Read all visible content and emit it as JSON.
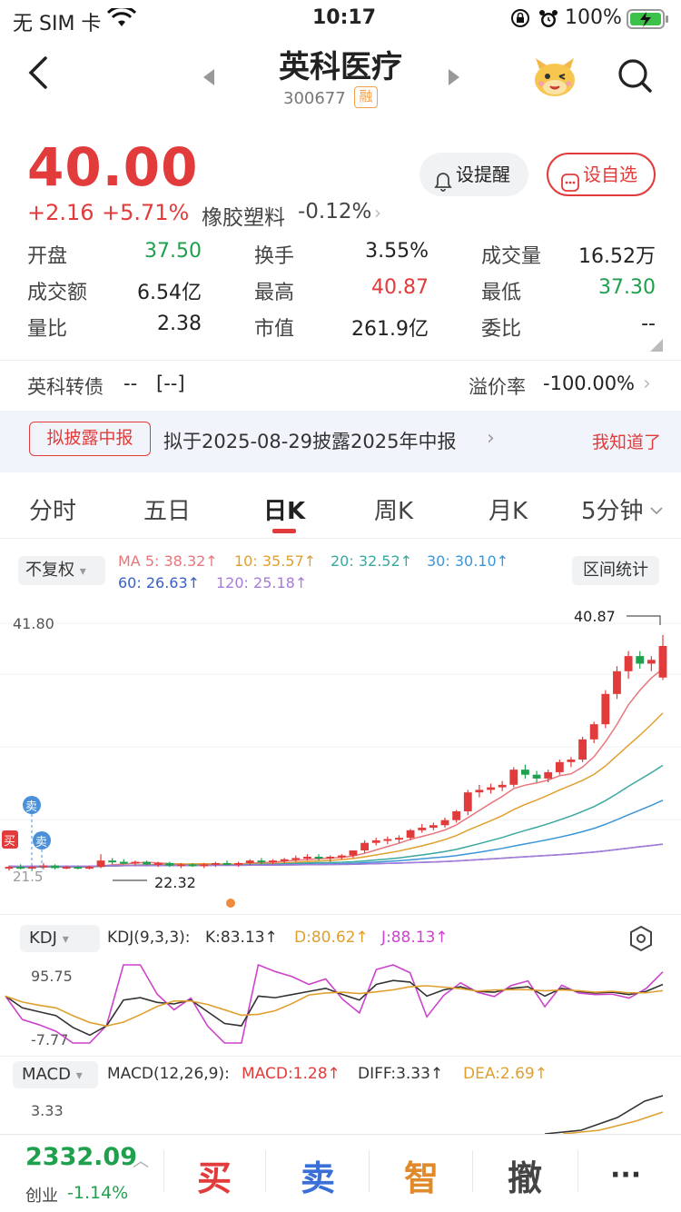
{
  "status": {
    "carrier": "无 SIM 卡",
    "time": "10:17",
    "battery": "100%"
  },
  "header": {
    "title": "英科医疗",
    "code": "300677",
    "badge": "融"
  },
  "price": {
    "last": "40.00",
    "change": "+2.16",
    "change_pct": "+5.71%",
    "sector": "橡胶塑料",
    "sector_pct": "-0.12%",
    "remind_label": "设提醒",
    "fav_label": "设自选"
  },
  "stats": [
    {
      "label": "开盘",
      "value": "37.50",
      "color": "#1fa04d"
    },
    {
      "label": "换手",
      "value": "3.55%",
      "color": "#222222"
    },
    {
      "label": "成交量",
      "value": "16.52万",
      "color": "#222222"
    },
    {
      "label": "成交额",
      "value": "6.54亿",
      "color": "#222222"
    },
    {
      "label": "最高",
      "value": "40.87",
      "color": "#e23b3b"
    },
    {
      "label": "最低",
      "value": "37.30",
      "color": "#1fa04d"
    },
    {
      "label": "量比",
      "value": "2.38",
      "color": "#222222"
    },
    {
      "label": "市值",
      "value": "261.9亿",
      "color": "#222222"
    },
    {
      "label": "委比",
      "value": "--",
      "color": "#222222"
    }
  ],
  "bond": {
    "label": "英科转债",
    "value": "--",
    "bracket": "[--]",
    "premium_label": "溢价率",
    "premium_value": "-100.00%"
  },
  "notice": {
    "tag": "拟披露中报",
    "text": "拟于2025-08-29披露2025年中报",
    "dismiss": "我知道了"
  },
  "tabs": [
    "分时",
    "五日",
    "日K",
    "周K",
    "月K",
    "5分钟"
  ],
  "kline": {
    "adjust": "不复权",
    "stats_btn": "区间统计",
    "ma": [
      {
        "label": "MA 5: 38.32↑",
        "color": "#e8767a"
      },
      {
        "label": "10: 35.57↑",
        "color": "#e0a030"
      },
      {
        "label": "20: 32.52↑",
        "color": "#3aa8a0"
      },
      {
        "label": "30: 30.10↑",
        "color": "#3b96d8"
      },
      {
        "label": "60: 26.63↑",
        "color": "#3a5fc4"
      },
      {
        "label": "120: 25.18↑",
        "color": "#a87bd8"
      }
    ],
    "ymax_label": "41.80",
    "high_label": "40.87",
    "low_label": "22.32",
    "low_left_label": "21.5",
    "sell_marker": "卖",
    "buy_marker": "买"
  },
  "kdj": {
    "btn": "KDJ",
    "params": "KDJ(9,3,3):",
    "k": "K:83.13↑",
    "d": "D:80.62↑",
    "j": "J:88.13↑",
    "top_label": "95.75",
    "bottom_label": "-7.77",
    "colors": {
      "k": "#333333",
      "d": "#e0a030",
      "j": "#cc44cc"
    }
  },
  "macd": {
    "btn": "MACD",
    "params": "MACD(12,26,9):",
    "macd": "MACD:1.28↑",
    "diff": "DIFF:3.33↑",
    "dea": "DEA:2.69↑",
    "top_label": "3.33"
  },
  "chart_data": {
    "type": "candlestick",
    "title": "日K",
    "y_range": [
      21.5,
      41.8
    ],
    "candles": [
      [
        22.4,
        22.6,
        22.2,
        22.5
      ],
      [
        22.5,
        22.7,
        22.3,
        22.4
      ],
      [
        22.4,
        22.6,
        22.2,
        22.5
      ],
      [
        22.5,
        22.8,
        22.3,
        22.6
      ],
      [
        22.6,
        22.7,
        22.3,
        22.4
      ],
      [
        22.4,
        22.6,
        22.32,
        22.5
      ],
      [
        22.5,
        22.6,
        22.3,
        22.4
      ],
      [
        22.4,
        22.6,
        22.3,
        22.5
      ],
      [
        22.5,
        23.5,
        22.4,
        23.0
      ],
      [
        23.0,
        23.2,
        22.7,
        22.9
      ],
      [
        22.9,
        23.1,
        22.7,
        22.8
      ],
      [
        22.8,
        23.0,
        22.6,
        22.9
      ],
      [
        22.9,
        23.0,
        22.6,
        22.7
      ],
      [
        22.7,
        22.9,
        22.5,
        22.8
      ],
      [
        22.8,
        22.9,
        22.5,
        22.6
      ],
      [
        22.6,
        22.8,
        22.4,
        22.7
      ],
      [
        22.7,
        22.8,
        22.5,
        22.6
      ],
      [
        22.6,
        22.8,
        22.4,
        22.7
      ],
      [
        22.7,
        22.9,
        22.5,
        22.8
      ],
      [
        22.8,
        23.0,
        22.6,
        22.7
      ],
      [
        22.7,
        22.9,
        22.5,
        22.8
      ],
      [
        22.8,
        23.1,
        22.6,
        23.0
      ],
      [
        23.0,
        23.2,
        22.7,
        22.9
      ],
      [
        22.9,
        23.1,
        22.7,
        23.0
      ],
      [
        23.0,
        23.2,
        22.8,
        23.1
      ],
      [
        23.1,
        23.4,
        22.9,
        23.2
      ],
      [
        23.2,
        23.5,
        23.0,
        23.3
      ],
      [
        23.3,
        23.5,
        23.0,
        23.2
      ],
      [
        23.2,
        23.4,
        22.9,
        23.3
      ],
      [
        23.3,
        23.5,
        23.1,
        23.4
      ],
      [
        23.4,
        23.6,
        23.2,
        23.8
      ],
      [
        23.8,
        24.6,
        23.6,
        24.4
      ],
      [
        24.4,
        24.8,
        24.2,
        24.6
      ],
      [
        24.6,
        24.9,
        24.3,
        24.7
      ],
      [
        24.7,
        25.0,
        24.4,
        24.8
      ],
      [
        24.8,
        25.5,
        24.6,
        25.4
      ],
      [
        25.4,
        25.9,
        25.2,
        25.6
      ],
      [
        25.6,
        26.0,
        25.4,
        25.8
      ],
      [
        25.8,
        26.4,
        25.6,
        26.2
      ],
      [
        26.2,
        27.0,
        26.0,
        26.9
      ],
      [
        26.9,
        28.6,
        26.6,
        28.4
      ],
      [
        28.4,
        29.0,
        28.0,
        28.6
      ],
      [
        28.6,
        29.1,
        28.3,
        28.8
      ],
      [
        28.8,
        29.3,
        28.5,
        29.0
      ],
      [
        29.0,
        30.4,
        28.8,
        30.2
      ],
      [
        30.2,
        30.6,
        29.5,
        29.8
      ],
      [
        29.8,
        30.1,
        29.2,
        29.5
      ],
      [
        29.5,
        30.2,
        29.2,
        30.0
      ],
      [
        30.0,
        31.0,
        29.8,
        30.8
      ],
      [
        30.8,
        31.2,
        30.4,
        31.0
      ],
      [
        31.0,
        32.8,
        30.8,
        32.6
      ],
      [
        32.6,
        34.0,
        32.3,
        33.8
      ],
      [
        33.8,
        36.5,
        33.5,
        36.2
      ],
      [
        36.2,
        38.4,
        35.8,
        38.0
      ],
      [
        38.0,
        39.6,
        37.4,
        39.2
      ],
      [
        39.2,
        39.6,
        38.2,
        38.6
      ],
      [
        38.6,
        39.2,
        38.0,
        38.9
      ],
      [
        37.5,
        40.87,
        37.3,
        40.0
      ]
    ]
  }
}
